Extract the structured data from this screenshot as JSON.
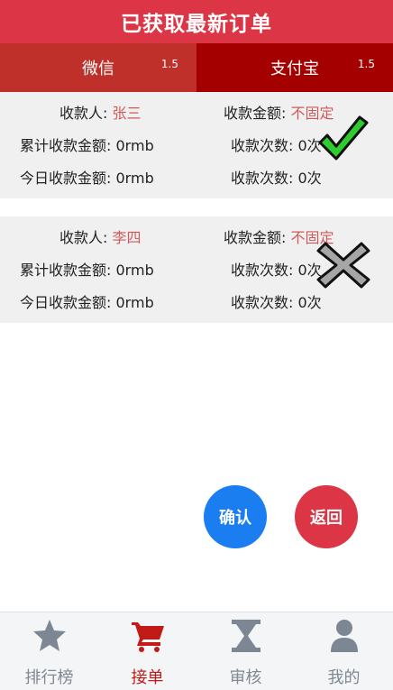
{
  "header": {
    "title": "已获取最新订单"
  },
  "tabs": [
    {
      "label": "微信",
      "badge": "1.5"
    },
    {
      "label": "支付宝",
      "badge": "1.5"
    }
  ],
  "orders": [
    {
      "payee_label": "收款人:",
      "payee": "张三",
      "amount_label": "收款金额:",
      "amount": "不固定",
      "total_label": "累计收款金额:",
      "total": "0rmb",
      "count_label": "收款次数:",
      "count": "0次",
      "today_label": "今日收款金额:",
      "today": "0rmb",
      "count2_label": "收款次数:",
      "count2": "0次",
      "status_icon": "check-icon"
    },
    {
      "payee_label": "收款人:",
      "payee": "李四",
      "amount_label": "收款金额:",
      "amount": "不固定",
      "total_label": "累计收款金额:",
      "total": "0rmb",
      "count_label": "收款次数:",
      "count": "0次",
      "today_label": "今日收款金额:",
      "today": "0rmb",
      "count2_label": "收款次数:",
      "count2": "0次",
      "status_icon": "cross-icon"
    }
  ],
  "actions": {
    "confirm": "确认",
    "back": "返回"
  },
  "nav": [
    {
      "label": "排行榜",
      "icon": "star-icon"
    },
    {
      "label": "接单",
      "icon": "cart-icon",
      "active": true
    },
    {
      "label": "审核",
      "icon": "hourglass-icon"
    },
    {
      "label": "我的",
      "icon": "user-icon"
    }
  ],
  "colors": {
    "primary_red": "#dc3545",
    "wechat_tab": "#c0302a",
    "alipay_tab": "#a50000",
    "confirm_blue": "#1a7df0",
    "highlight_text": "#d05a5a"
  }
}
